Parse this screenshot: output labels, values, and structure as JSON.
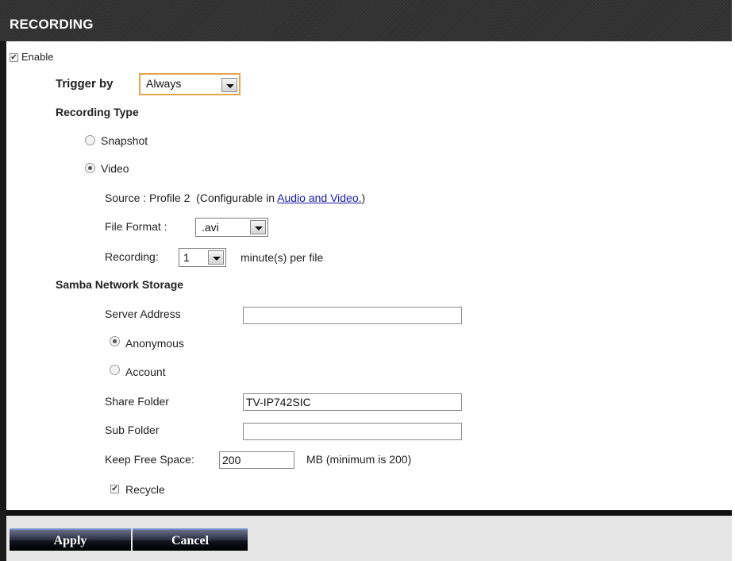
{
  "header": {
    "title": "RECORDING"
  },
  "enable": {
    "label": "Enable",
    "checked": true
  },
  "trigger": {
    "label": "Trigger by",
    "value": "Always"
  },
  "recording_type": {
    "label": "Recording Type",
    "options": [
      {
        "label": "Snapshot",
        "selected": false
      },
      {
        "label": "Video",
        "selected": true
      }
    ]
  },
  "video": {
    "source_text": "Source : Profile 2  (Configurable in ",
    "source_link": "Audio and Video.",
    "source_suffix": ")",
    "file_format_label": "File Format :",
    "file_format_value": ".avi",
    "recording_label": "Recording:",
    "recording_value": "1",
    "recording_suffix": "minute(s) per file"
  },
  "samba": {
    "label": "Samba Network Storage",
    "server_address_label": "Server Address",
    "server_address_value": "",
    "auth_options": [
      {
        "label": "Anonymous",
        "selected": true
      },
      {
        "label": "Account",
        "selected": false
      }
    ],
    "share_folder_label": "Share Folder",
    "share_folder_value": "TV-IP742SIC",
    "sub_folder_label": "Sub Folder",
    "sub_folder_value": "",
    "keep_free_label": "Keep Free Space:",
    "keep_free_value": "200",
    "keep_free_suffix": "MB (minimum is 200)",
    "recycle_label": "Recycle",
    "recycle_checked": true
  },
  "footer": {
    "apply_label": "Apply",
    "cancel_label": "Cancel"
  },
  "colors": {
    "header_bg": "#333333",
    "link": "#1a1aa6",
    "select_highlight": "#e2a64b"
  },
  "icons": {
    "checkbox": "checkmark-icon",
    "dropdown": "chevron-down-icon"
  }
}
